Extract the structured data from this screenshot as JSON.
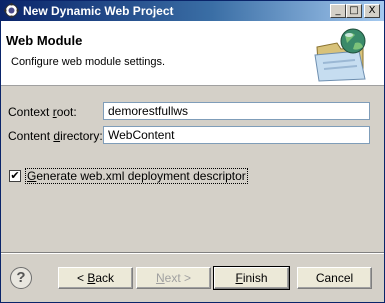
{
  "window": {
    "title": "New Dynamic Web Project",
    "minimize": "_",
    "maximize": "□",
    "close": "X"
  },
  "header": {
    "title": "Web Module",
    "description": "Configure web module settings."
  },
  "form": {
    "context_root": {
      "label_prefix": "Context ",
      "label_mnemonic": "r",
      "label_suffix": "oot:",
      "value": "demorestfullws"
    },
    "content_directory": {
      "label_prefix": "Content ",
      "label_mnemonic": "d",
      "label_suffix": "irectory:",
      "value": "WebContent"
    },
    "generate_descriptor": {
      "checked_mark": "✔",
      "label_mnemonic": "G",
      "label_suffix": "enerate web.xml deployment descriptor"
    }
  },
  "footer": {
    "help_glyph": "?",
    "back": {
      "prefix": "< ",
      "mnemonic": "B",
      "suffix": "ack"
    },
    "next": {
      "prefix": "",
      "mnemonic": "N",
      "suffix": "ext >"
    },
    "finish": {
      "prefix": "",
      "mnemonic": "F",
      "suffix": "inish"
    },
    "cancel": {
      "label": "Cancel"
    }
  },
  "icons": {
    "title_icon": "eclipse-gear-icon",
    "banner": "web-globe-folder-icon",
    "help": "help-icon"
  }
}
